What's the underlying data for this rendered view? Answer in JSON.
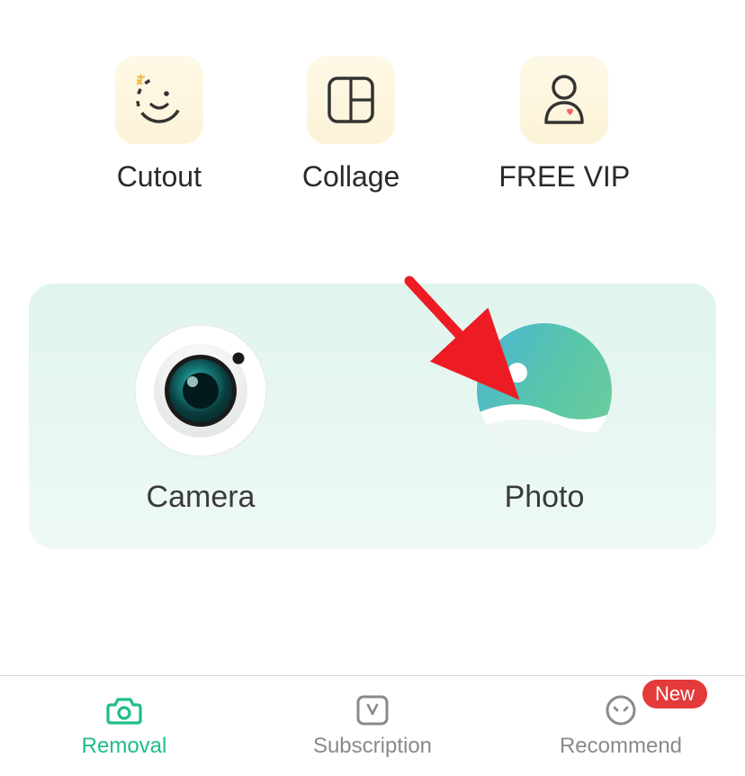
{
  "features": [
    {
      "label": "Cutout"
    },
    {
      "label": "Collage"
    },
    {
      "label": "FREE VIP"
    }
  ],
  "actions": {
    "camera": "Camera",
    "photo": "Photo"
  },
  "nav": {
    "removal": "Removal",
    "subscription": "Subscription",
    "recommend": "Recommend",
    "badge": "New"
  }
}
